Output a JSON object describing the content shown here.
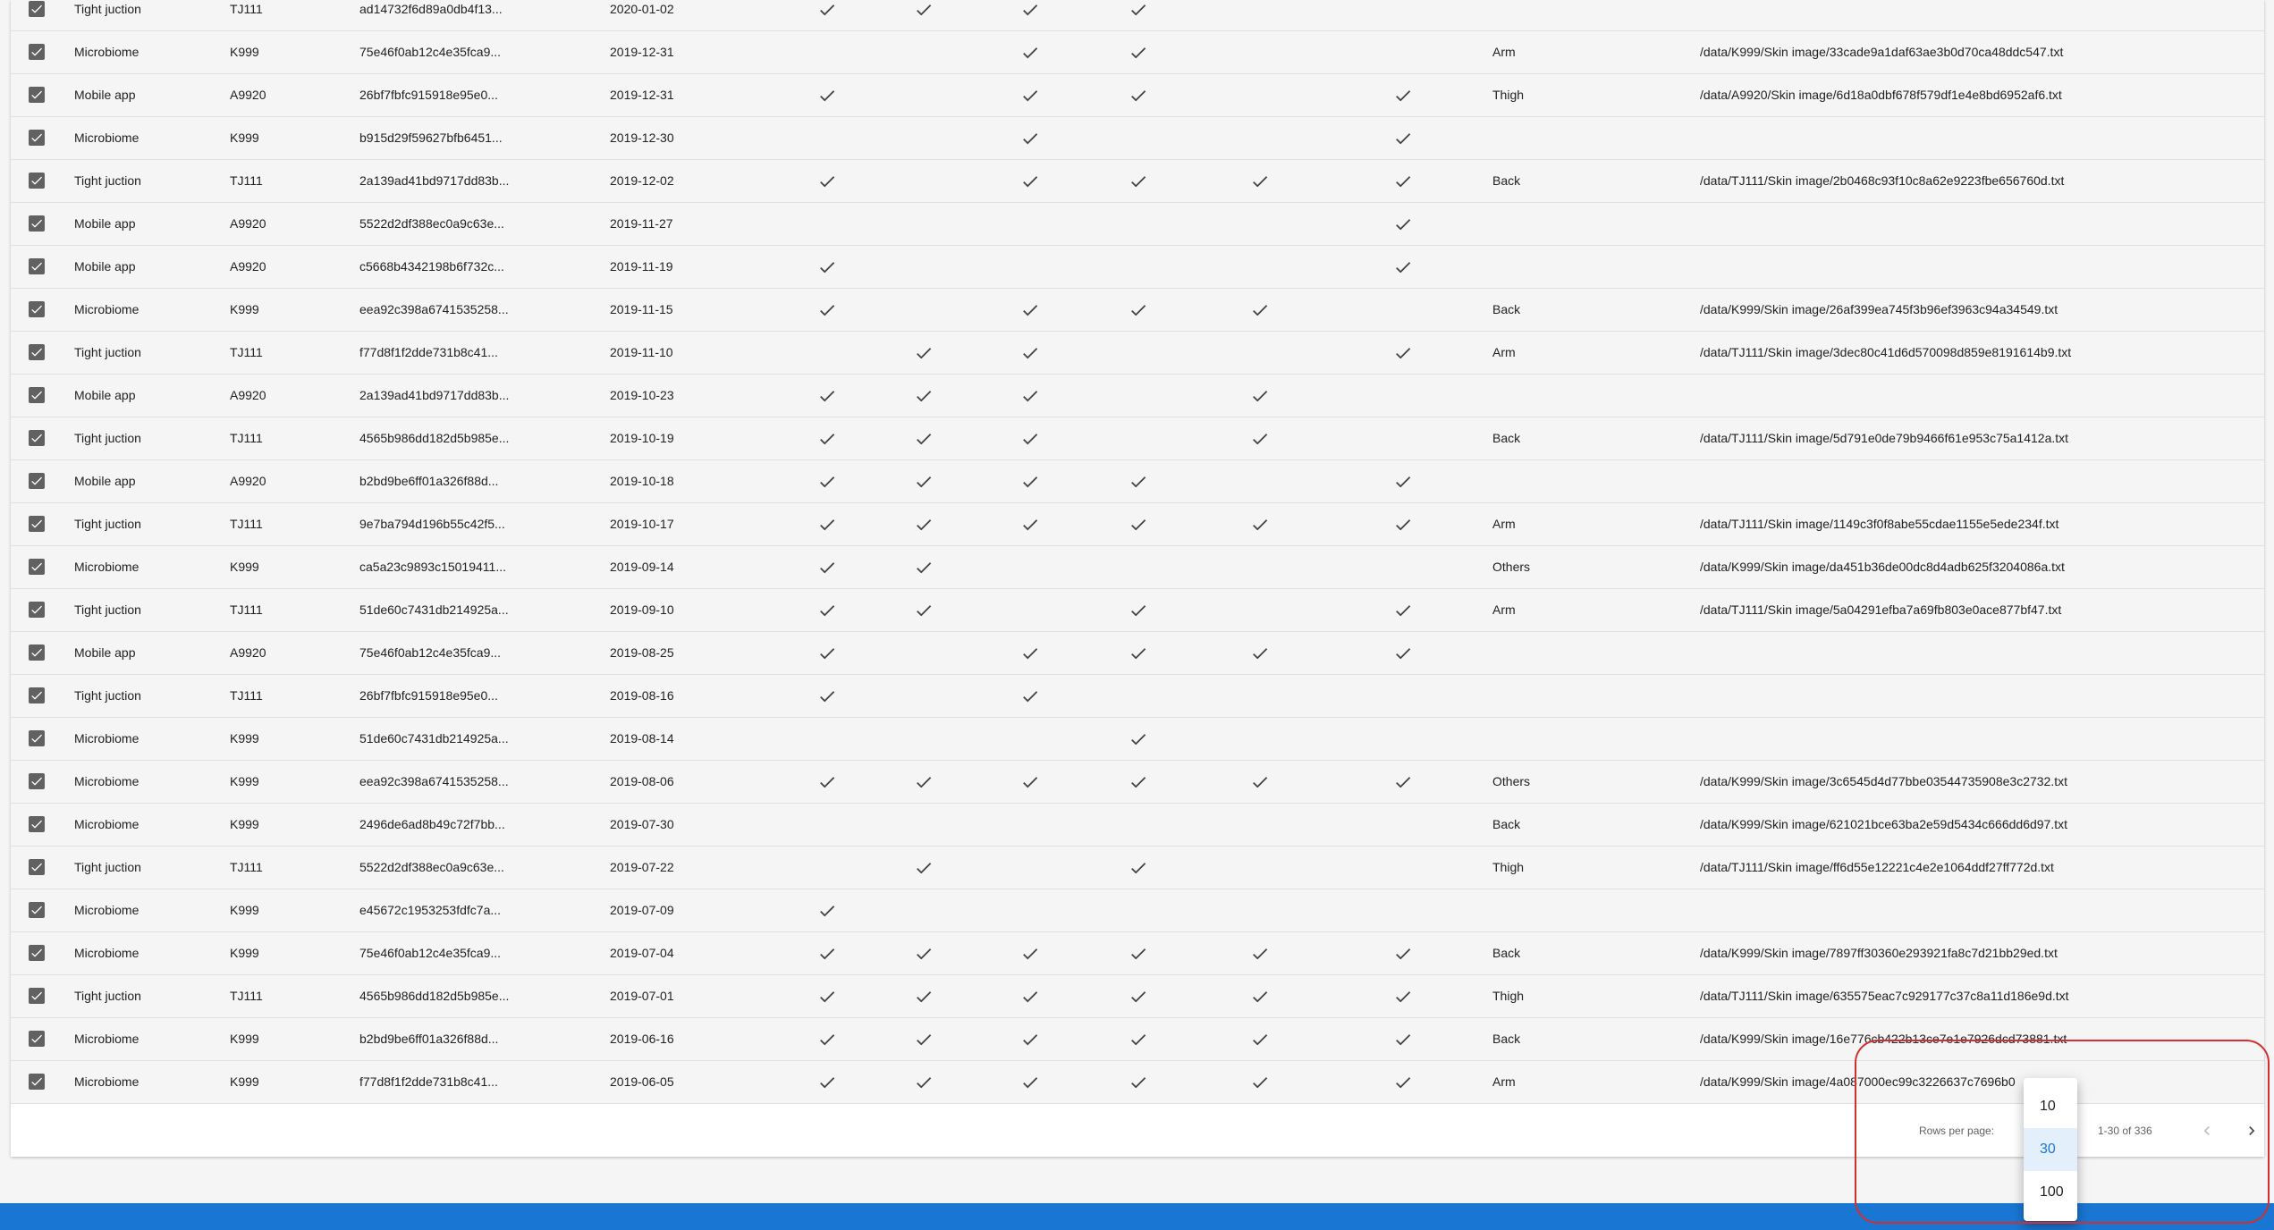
{
  "table": {
    "rows": [
      {
        "category": "Tight juction",
        "code": "TJ111",
        "hash": "ad14732f6d89a0db4f13...",
        "date": "2020-01-02",
        "checks": [
          1,
          1,
          1,
          1,
          0,
          0
        ],
        "part": "",
        "path": ""
      },
      {
        "category": "Microbiome",
        "code": "K999",
        "hash": "75e46f0ab12c4e35fca9...",
        "date": "2019-12-31",
        "checks": [
          0,
          0,
          1,
          1,
          0,
          0
        ],
        "part": "Arm",
        "path": "/data/K999/Skin image/33cade9a1daf63ae3b0d70ca48ddc547.txt"
      },
      {
        "category": "Mobile app",
        "code": "A9920",
        "hash": "26bf7fbfc915918e95e0...",
        "date": "2019-12-31",
        "checks": [
          1,
          0,
          1,
          1,
          0,
          1
        ],
        "part": "Thigh",
        "path": "/data/A9920/Skin image/6d18a0dbf678f579df1e4e8bd6952af6.txt"
      },
      {
        "category": "Microbiome",
        "code": "K999",
        "hash": "b915d29f59627bfb6451...",
        "date": "2019-12-30",
        "checks": [
          0,
          0,
          1,
          0,
          0,
          1
        ],
        "part": "",
        "path": ""
      },
      {
        "category": "Tight juction",
        "code": "TJ111",
        "hash": "2a139ad41bd9717dd83b...",
        "date": "2019-12-02",
        "checks": [
          1,
          0,
          1,
          1,
          1,
          1
        ],
        "part": "Back",
        "path": "/data/TJ111/Skin image/2b0468c93f10c8a62e9223fbe656760d.txt"
      },
      {
        "category": "Mobile app",
        "code": "A9920",
        "hash": "5522d2df388ec0a9c63e...",
        "date": "2019-11-27",
        "checks": [
          0,
          0,
          0,
          0,
          0,
          1
        ],
        "part": "",
        "path": ""
      },
      {
        "category": "Mobile app",
        "code": "A9920",
        "hash": "c5668b4342198b6f732c...",
        "date": "2019-11-19",
        "checks": [
          1,
          0,
          0,
          0,
          0,
          1
        ],
        "part": "",
        "path": ""
      },
      {
        "category": "Microbiome",
        "code": "K999",
        "hash": "eea92c398a6741535258...",
        "date": "2019-11-15",
        "checks": [
          1,
          0,
          1,
          1,
          1,
          0
        ],
        "part": "Back",
        "path": "/data/K999/Skin image/26af399ea745f3b96ef3963c94a34549.txt"
      },
      {
        "category": "Tight juction",
        "code": "TJ111",
        "hash": "f77d8f1f2dde731b8c41...",
        "date": "2019-11-10",
        "checks": [
          0,
          1,
          1,
          0,
          0,
          1
        ],
        "part": "Arm",
        "path": "/data/TJ111/Skin image/3dec80c41d6d570098d859e8191614b9.txt"
      },
      {
        "category": "Mobile app",
        "code": "A9920",
        "hash": "2a139ad41bd9717dd83b...",
        "date": "2019-10-23",
        "checks": [
          1,
          1,
          1,
          0,
          1,
          0
        ],
        "part": "",
        "path": ""
      },
      {
        "category": "Tight juction",
        "code": "TJ111",
        "hash": "4565b986dd182d5b985e...",
        "date": "2019-10-19",
        "checks": [
          1,
          1,
          1,
          0,
          1,
          0
        ],
        "part": "Back",
        "path": "/data/TJ111/Skin image/5d791e0de79b9466f61e953c75a1412a.txt"
      },
      {
        "category": "Mobile app",
        "code": "A9920",
        "hash": "b2bd9be6ff01a326f88d...",
        "date": "2019-10-18",
        "checks": [
          1,
          1,
          1,
          1,
          0,
          1
        ],
        "part": "",
        "path": ""
      },
      {
        "category": "Tight juction",
        "code": "TJ111",
        "hash": "9e7ba794d196b55c42f5...",
        "date": "2019-10-17",
        "checks": [
          1,
          1,
          1,
          1,
          1,
          1
        ],
        "part": "Arm",
        "path": "/data/TJ111/Skin image/1149c3f0f8abe55cdae1155e5ede234f.txt"
      },
      {
        "category": "Microbiome",
        "code": "K999",
        "hash": "ca5a23c9893c15019411...",
        "date": "2019-09-14",
        "checks": [
          1,
          1,
          0,
          0,
          0,
          0
        ],
        "part": "Others",
        "path": "/data/K999/Skin image/da451b36de00dc8d4adb625f3204086a.txt"
      },
      {
        "category": "Tight juction",
        "code": "TJ111",
        "hash": "51de60c7431db214925a...",
        "date": "2019-09-10",
        "checks": [
          1,
          1,
          0,
          1,
          0,
          1
        ],
        "part": "Arm",
        "path": "/data/TJ111/Skin image/5a04291efba7a69fb803e0ace877bf47.txt"
      },
      {
        "category": "Mobile app",
        "code": "A9920",
        "hash": "75e46f0ab12c4e35fca9...",
        "date": "2019-08-25",
        "checks": [
          1,
          0,
          1,
          1,
          1,
          1
        ],
        "part": "",
        "path": ""
      },
      {
        "category": "Tight juction",
        "code": "TJ111",
        "hash": "26bf7fbfc915918e95e0...",
        "date": "2019-08-16",
        "checks": [
          1,
          0,
          1,
          0,
          0,
          0
        ],
        "part": "",
        "path": ""
      },
      {
        "category": "Microbiome",
        "code": "K999",
        "hash": "51de60c7431db214925a...",
        "date": "2019-08-14",
        "checks": [
          0,
          0,
          0,
          1,
          0,
          0
        ],
        "part": "",
        "path": ""
      },
      {
        "category": "Microbiome",
        "code": "K999",
        "hash": "eea92c398a6741535258...",
        "date": "2019-08-06",
        "checks": [
          1,
          1,
          1,
          1,
          1,
          1
        ],
        "part": "Others",
        "path": "/data/K999/Skin image/3c6545d4d77bbe03544735908e3c2732.txt"
      },
      {
        "category": "Microbiome",
        "code": "K999",
        "hash": "2496de6ad8b49c72f7bb...",
        "date": "2019-07-30",
        "checks": [
          0,
          0,
          0,
          0,
          0,
          0
        ],
        "part": "Back",
        "path": "/data/K999/Skin image/621021bce63ba2e59d5434c666dd6d97.txt"
      },
      {
        "category": "Tight juction",
        "code": "TJ111",
        "hash": "5522d2df388ec0a9c63e...",
        "date": "2019-07-22",
        "checks": [
          0,
          1,
          0,
          1,
          0,
          0
        ],
        "part": "Thigh",
        "path": "/data/TJ111/Skin image/ff6d55e12221c4e2e1064ddf27ff772d.txt"
      },
      {
        "category": "Microbiome",
        "code": "K999",
        "hash": "e45672c1953253fdfc7a...",
        "date": "2019-07-09",
        "checks": [
          1,
          0,
          0,
          0,
          0,
          0
        ],
        "part": "",
        "path": ""
      },
      {
        "category": "Microbiome",
        "code": "K999",
        "hash": "75e46f0ab12c4e35fca9...",
        "date": "2019-07-04",
        "checks": [
          1,
          1,
          1,
          1,
          1,
          1
        ],
        "part": "Back",
        "path": "/data/K999/Skin image/7897ff30360e293921fa8c7d21bb29ed.txt"
      },
      {
        "category": "Tight juction",
        "code": "TJ111",
        "hash": "4565b986dd182d5b985e...",
        "date": "2019-07-01",
        "checks": [
          1,
          1,
          1,
          1,
          1,
          1
        ],
        "part": "Thigh",
        "path": "/data/TJ111/Skin image/635575eac7c929177c37c8a11d186e9d.txt"
      },
      {
        "category": "Microbiome",
        "code": "K999",
        "hash": "b2bd9be6ff01a326f88d...",
        "date": "2019-06-16",
        "checks": [
          1,
          1,
          1,
          1,
          1,
          1
        ],
        "part": "Back",
        "path": "/data/K999/Skin image/16e776cb422b13ce7e1e7926dcd73881.txt"
      },
      {
        "category": "Microbiome",
        "code": "K999",
        "hash": "f77d8f1f2dde731b8c41...",
        "date": "2019-06-05",
        "checks": [
          1,
          1,
          1,
          1,
          1,
          1
        ],
        "part": "Arm",
        "path": "/data/K999/Skin image/4a087000ec99c3226637c7696b0"
      }
    ]
  },
  "pagination": {
    "rows_per_page_label": "Rows per page:",
    "range_text": "1-30 of 336",
    "options": [
      "10",
      "30",
      "100"
    ],
    "selected": "30"
  },
  "colors": {
    "accent": "#1976d2",
    "highlight": "#d32f2f",
    "check": "#424242",
    "checkbox": "#616161"
  }
}
